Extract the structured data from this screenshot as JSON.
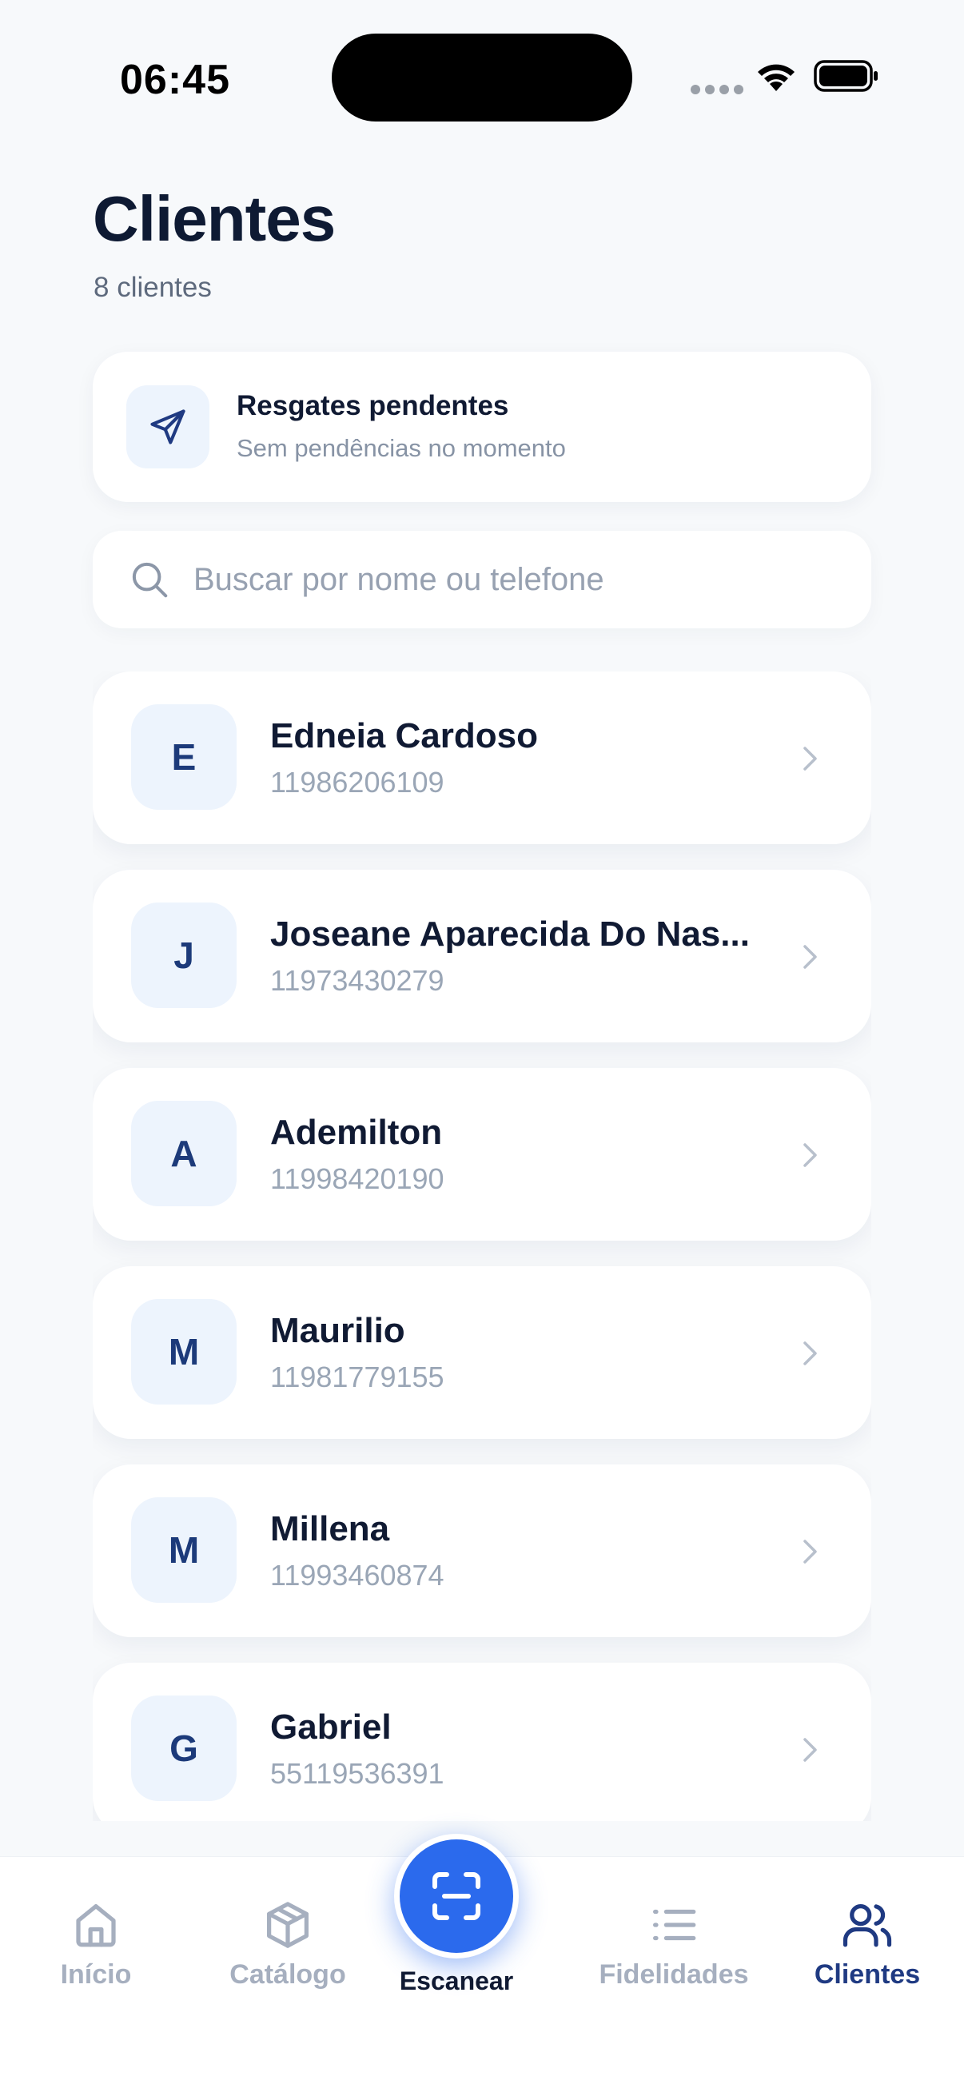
{
  "status_bar": {
    "time": "06:45"
  },
  "header": {
    "title": "Clientes",
    "subtitle": "8 clientes"
  },
  "pending": {
    "title": "Resgates pendentes",
    "subtitle": "Sem pendências no momento",
    "icon": "send-icon"
  },
  "search": {
    "placeholder": "Buscar por nome ou telefone",
    "value": ""
  },
  "clients": [
    {
      "initial": "E",
      "name": "Edneia Cardoso",
      "phone": "11986206109"
    },
    {
      "initial": "J",
      "name": "Joseane Aparecida Do Nas...",
      "phone": "11973430279"
    },
    {
      "initial": "A",
      "name": "Ademilton",
      "phone": "11998420190"
    },
    {
      "initial": "M",
      "name": "Maurilio",
      "phone": "11981779155"
    },
    {
      "initial": "M",
      "name": "Millena",
      "phone": "11993460874"
    },
    {
      "initial": "G",
      "name": "Gabriel",
      "phone": "55119536391"
    }
  ],
  "tabs": [
    {
      "label": "Início",
      "icon": "home-icon",
      "active": false
    },
    {
      "label": "Catálogo",
      "icon": "box-icon",
      "active": false
    },
    {
      "label": "Escanear",
      "icon": "scan-icon",
      "active": false
    },
    {
      "label": "Fidelidades",
      "icon": "list-icon",
      "active": false
    },
    {
      "label": "Clientes",
      "icon": "users-icon",
      "active": true
    }
  ],
  "colors": {
    "accent": "#2b6aed",
    "active_tab": "#1f3a82",
    "inactive_tab": "#a6afbf",
    "avatar_bg": "#edf4fd"
  }
}
